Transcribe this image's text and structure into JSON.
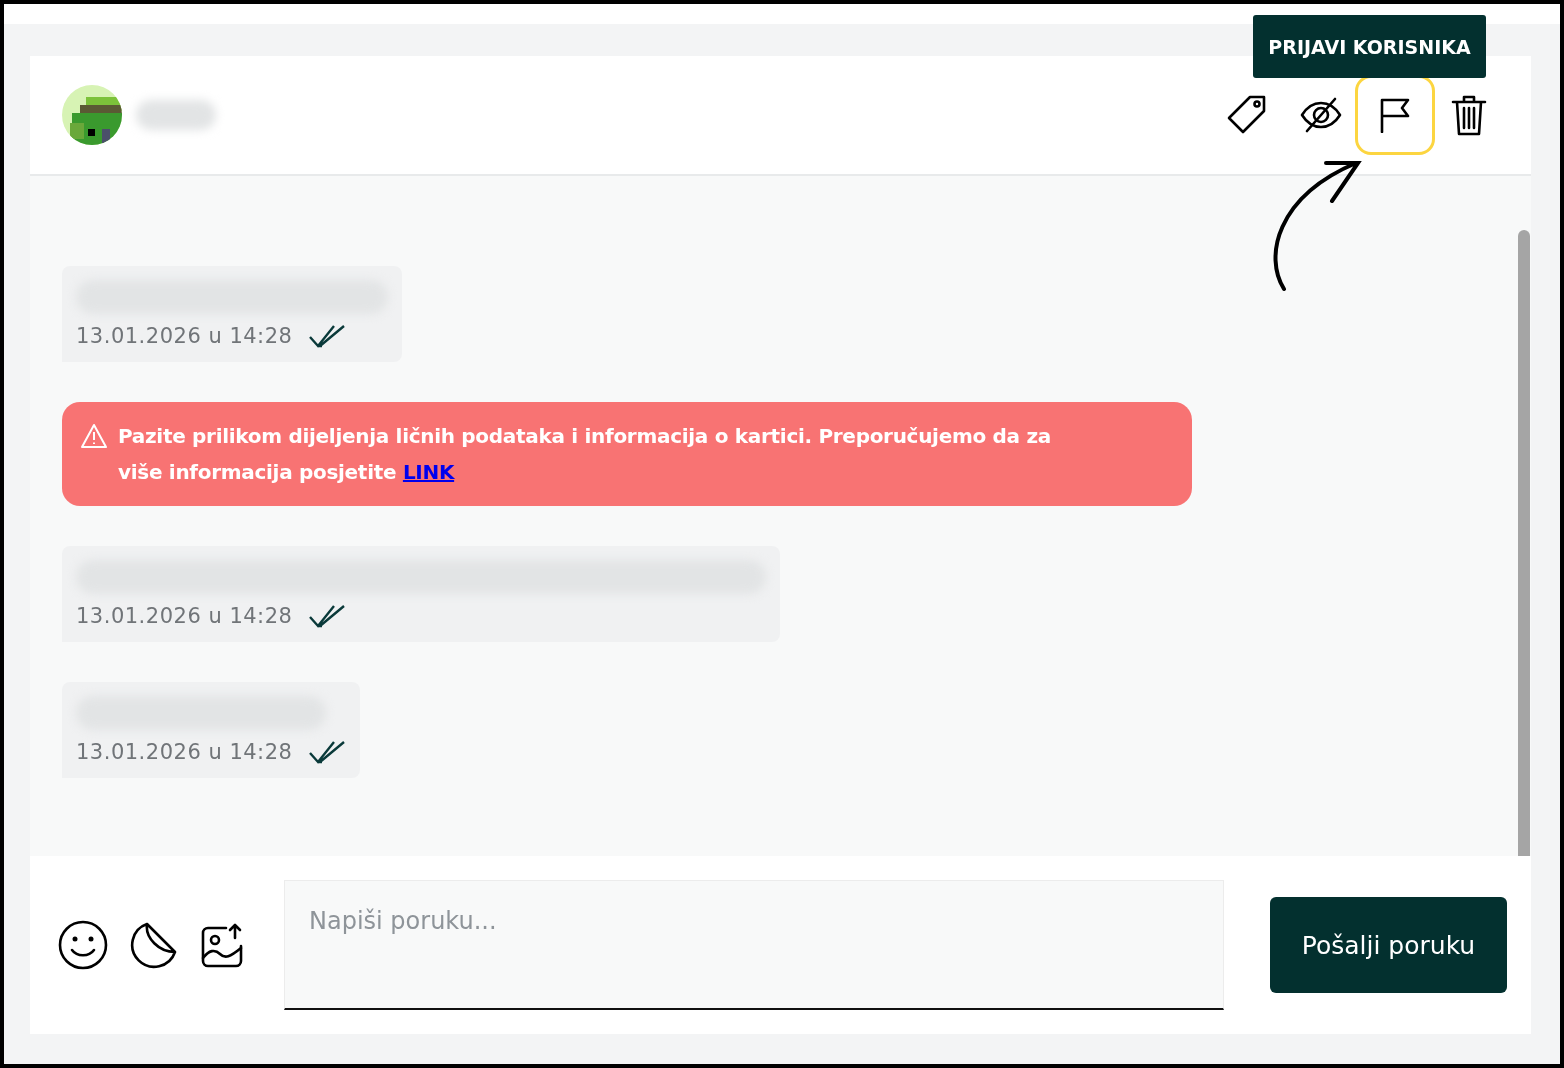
{
  "header": {
    "actions": [
      {
        "kind": "tag",
        "highlighted": false
      },
      {
        "kind": "hide",
        "highlighted": false
      },
      {
        "kind": "report",
        "highlighted": true
      },
      {
        "kind": "delete",
        "highlighted": false
      }
    ],
    "tooltip": "PRIJAVI KORISNIKA"
  },
  "messages": [
    {
      "kind": "bubble",
      "time": "13.01.2026 u 14:28",
      "read": true
    },
    {
      "kind": "warning",
      "text": "Pazite prilikom dijeljenja ličnih podataka i informacija o kartici. Preporučujemo da za više informacija posjetite",
      "link": "LINK"
    },
    {
      "kind": "bubble",
      "time": "13.01.2026 u 14:28",
      "read": true
    },
    {
      "kind": "bubble",
      "time": "13.01.2026 u 14:28",
      "read": true
    }
  ],
  "composer": {
    "placeholder": "Napiši poruku...",
    "send": "Pošalji poruku"
  }
}
